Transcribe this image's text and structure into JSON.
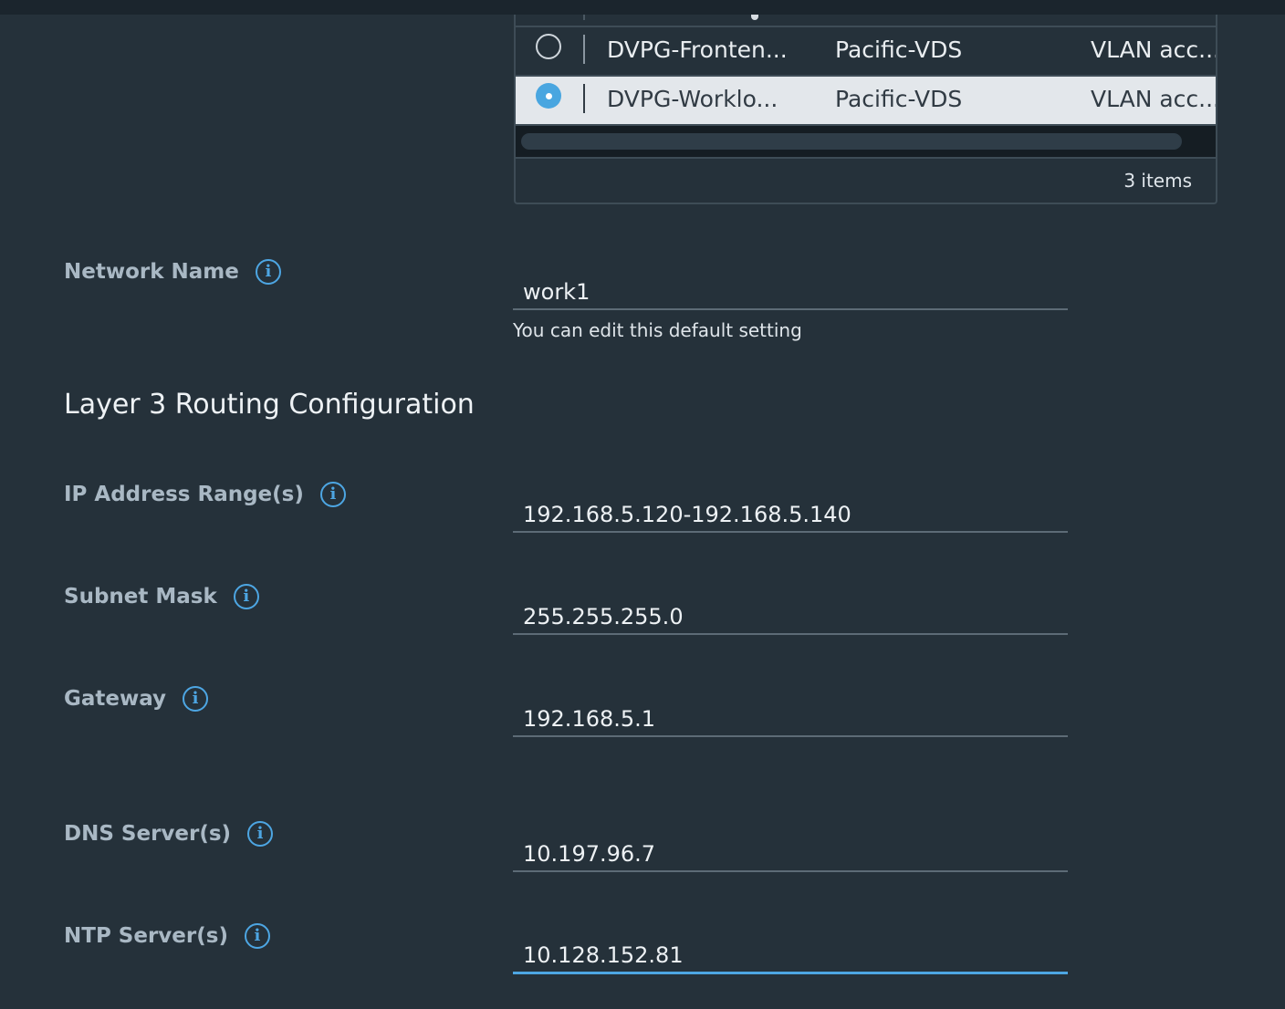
{
  "grid": {
    "rows": [
      {
        "name": "DVPG-Fronten...",
        "switch": "Pacific-VDS",
        "type": "VLAN acc...",
        "selected": false
      },
      {
        "name": "DVPG-Worklo...",
        "switch": "Pacific-VDS",
        "type": "VLAN acc...",
        "selected": true
      }
    ],
    "footer": "3 items"
  },
  "network_name": {
    "label": "Network Name",
    "value": "work1",
    "hint": "You can edit this default setting"
  },
  "section_title": "Layer 3 Routing Configuration",
  "fields": {
    "ip_range": {
      "label": "IP Address Range(s)",
      "value": "192.168.5.120-192.168.5.140"
    },
    "subnet": {
      "label": "Subnet Mask",
      "value": "255.255.255.0"
    },
    "gateway": {
      "label": "Gateway",
      "value": "192.168.5.1"
    },
    "dns": {
      "label": "DNS Server(s)",
      "value": "10.197.96.7"
    },
    "ntp": {
      "label": "NTP Server(s)",
      "value": "10.128.152.81"
    }
  },
  "icons": {
    "info": "info-icon",
    "radio": "radio-button"
  },
  "colors": {
    "accent": "#49a6e0",
    "background": "#25313a",
    "selected_row": "#e3e7eb"
  }
}
